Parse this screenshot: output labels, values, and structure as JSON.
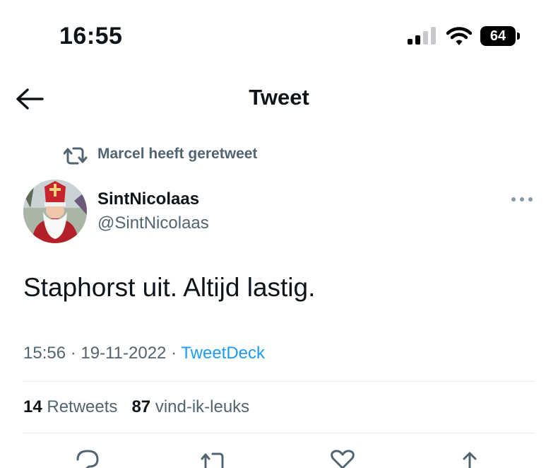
{
  "status_bar": {
    "time": "16:55",
    "battery": "64"
  },
  "header": {
    "title": "Tweet",
    "back_icon": "arrow-left-icon"
  },
  "retweet_context": {
    "label": "Marcel heeft geretweet",
    "icon": "retweet-icon"
  },
  "author": {
    "display_name": "SintNicolaas",
    "handle": "@SintNicolaas"
  },
  "tweet": {
    "text": "Staphorst uit. Altijd lastig.",
    "time": "15:56",
    "date": "19-11-2022",
    "source": "TweetDeck",
    "separator": "·"
  },
  "stats": {
    "retweets_count": "14",
    "retweets_label": "Retweets",
    "likes_count": "87",
    "likes_label": "vind-ik-leuks"
  },
  "actions": [
    "reply-icon",
    "retweet-icon",
    "like-icon",
    "share-icon"
  ],
  "colors": {
    "text": "#0f1419",
    "secondary": "#536471",
    "link": "#1d9bf0",
    "divider": "#e6ecf0"
  }
}
